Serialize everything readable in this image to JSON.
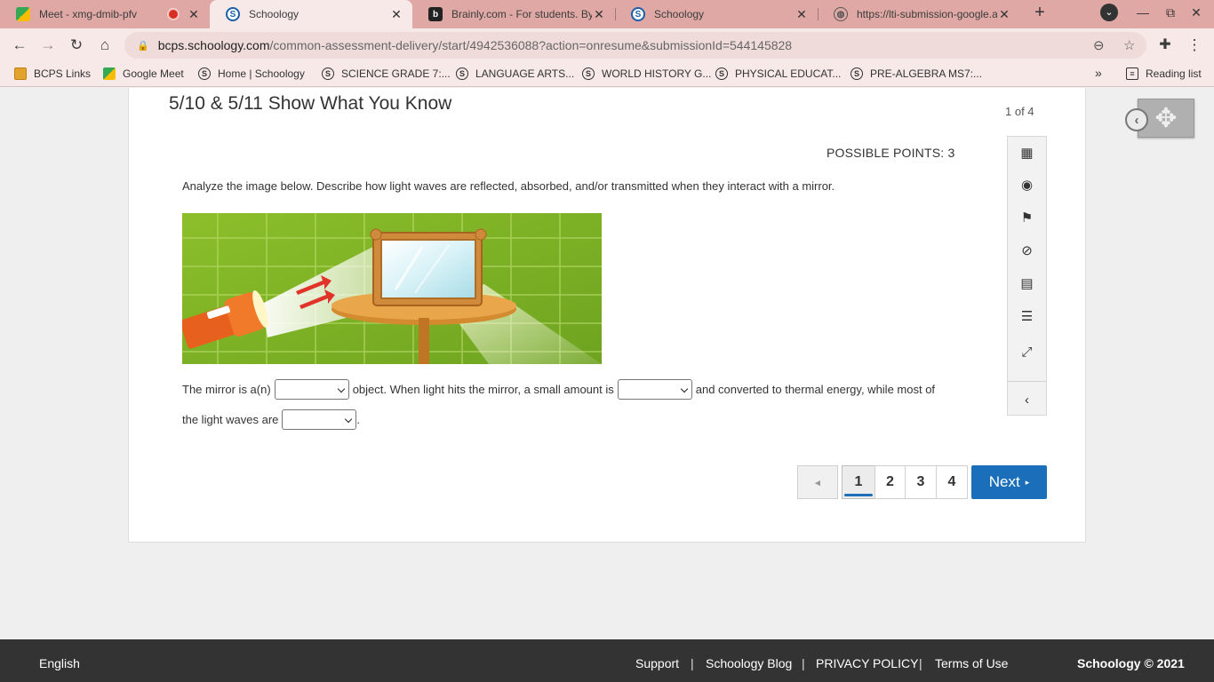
{
  "browser": {
    "tabs": [
      {
        "title": "Meet - xmg-dmib-pfv",
        "icon": "google-meet-icon",
        "recording": true
      },
      {
        "title": "Schoology",
        "icon": "schoology-icon",
        "active": true
      },
      {
        "title": "Brainly.com - For students. By students.",
        "icon": "brainly-icon"
      },
      {
        "title": "Schoology",
        "icon": "schoology-icon"
      },
      {
        "title": "https://lti-submission-google.app...",
        "icon": "globe-icon"
      }
    ],
    "new_tab": "+",
    "window_controls": {
      "menu": "⌄",
      "minimize": "—",
      "restore": "⧉",
      "close": "✕"
    },
    "url_host": "bcps.schoology.com",
    "url_path": "/common-assessment-delivery/start/4942536088?action=onresume&submissionId=544145828",
    "bookmarks": [
      {
        "label": "BCPS Links",
        "icon": "folder-icon"
      },
      {
        "label": "Google Meet",
        "icon": "google-meet-icon"
      },
      {
        "label": "Home | Schoology",
        "icon": "schoology-icon"
      },
      {
        "label": "SCIENCE GRADE 7:...",
        "icon": "schoology-icon"
      },
      {
        "label": "LANGUAGE ARTS...",
        "icon": "schoology-icon"
      },
      {
        "label": "WORLD HISTORY G...",
        "icon": "schoology-icon"
      },
      {
        "label": "PHYSICAL EDUCAT...",
        "icon": "schoology-icon"
      },
      {
        "label": "PRE-ALGEBRA MS7:...",
        "icon": "schoology-icon"
      }
    ],
    "more_bookmarks": "»",
    "reading_list": "Reading list"
  },
  "assessment": {
    "title": "5/10 & 5/11 Show What You Know",
    "counter": "1 of 4",
    "points": "POSSIBLE POINTS: 3",
    "prompt": "Analyze the image below.  Describe how light waves are reflected, absorbed, and/or transmitted when they interact with a mirror.",
    "sentence": {
      "part1": "The mirror is  a(n)",
      "part2": "object.  When light hits the mirror, a small amount  is",
      "part3": "and converted to thermal energy, while most of",
      "part4": "the light waves are",
      "part5": "."
    },
    "dropdowns": [
      "",
      "",
      ""
    ],
    "pages": [
      "1",
      "2",
      "3",
      "4"
    ],
    "current_page": "1",
    "prev_label": "◂",
    "next_label": "Next",
    "next_arrow": "▸"
  },
  "footer": {
    "language": "English",
    "links": [
      "Support",
      "Schoology Blog",
      "PRIVACY POLICY",
      "Terms of Use"
    ],
    "separator": "|",
    "copyright": "Schoology © 2021"
  },
  "colors": {
    "tabbar": "#dfa8a4",
    "accent": "#1b6fba",
    "footer": "#333333"
  }
}
